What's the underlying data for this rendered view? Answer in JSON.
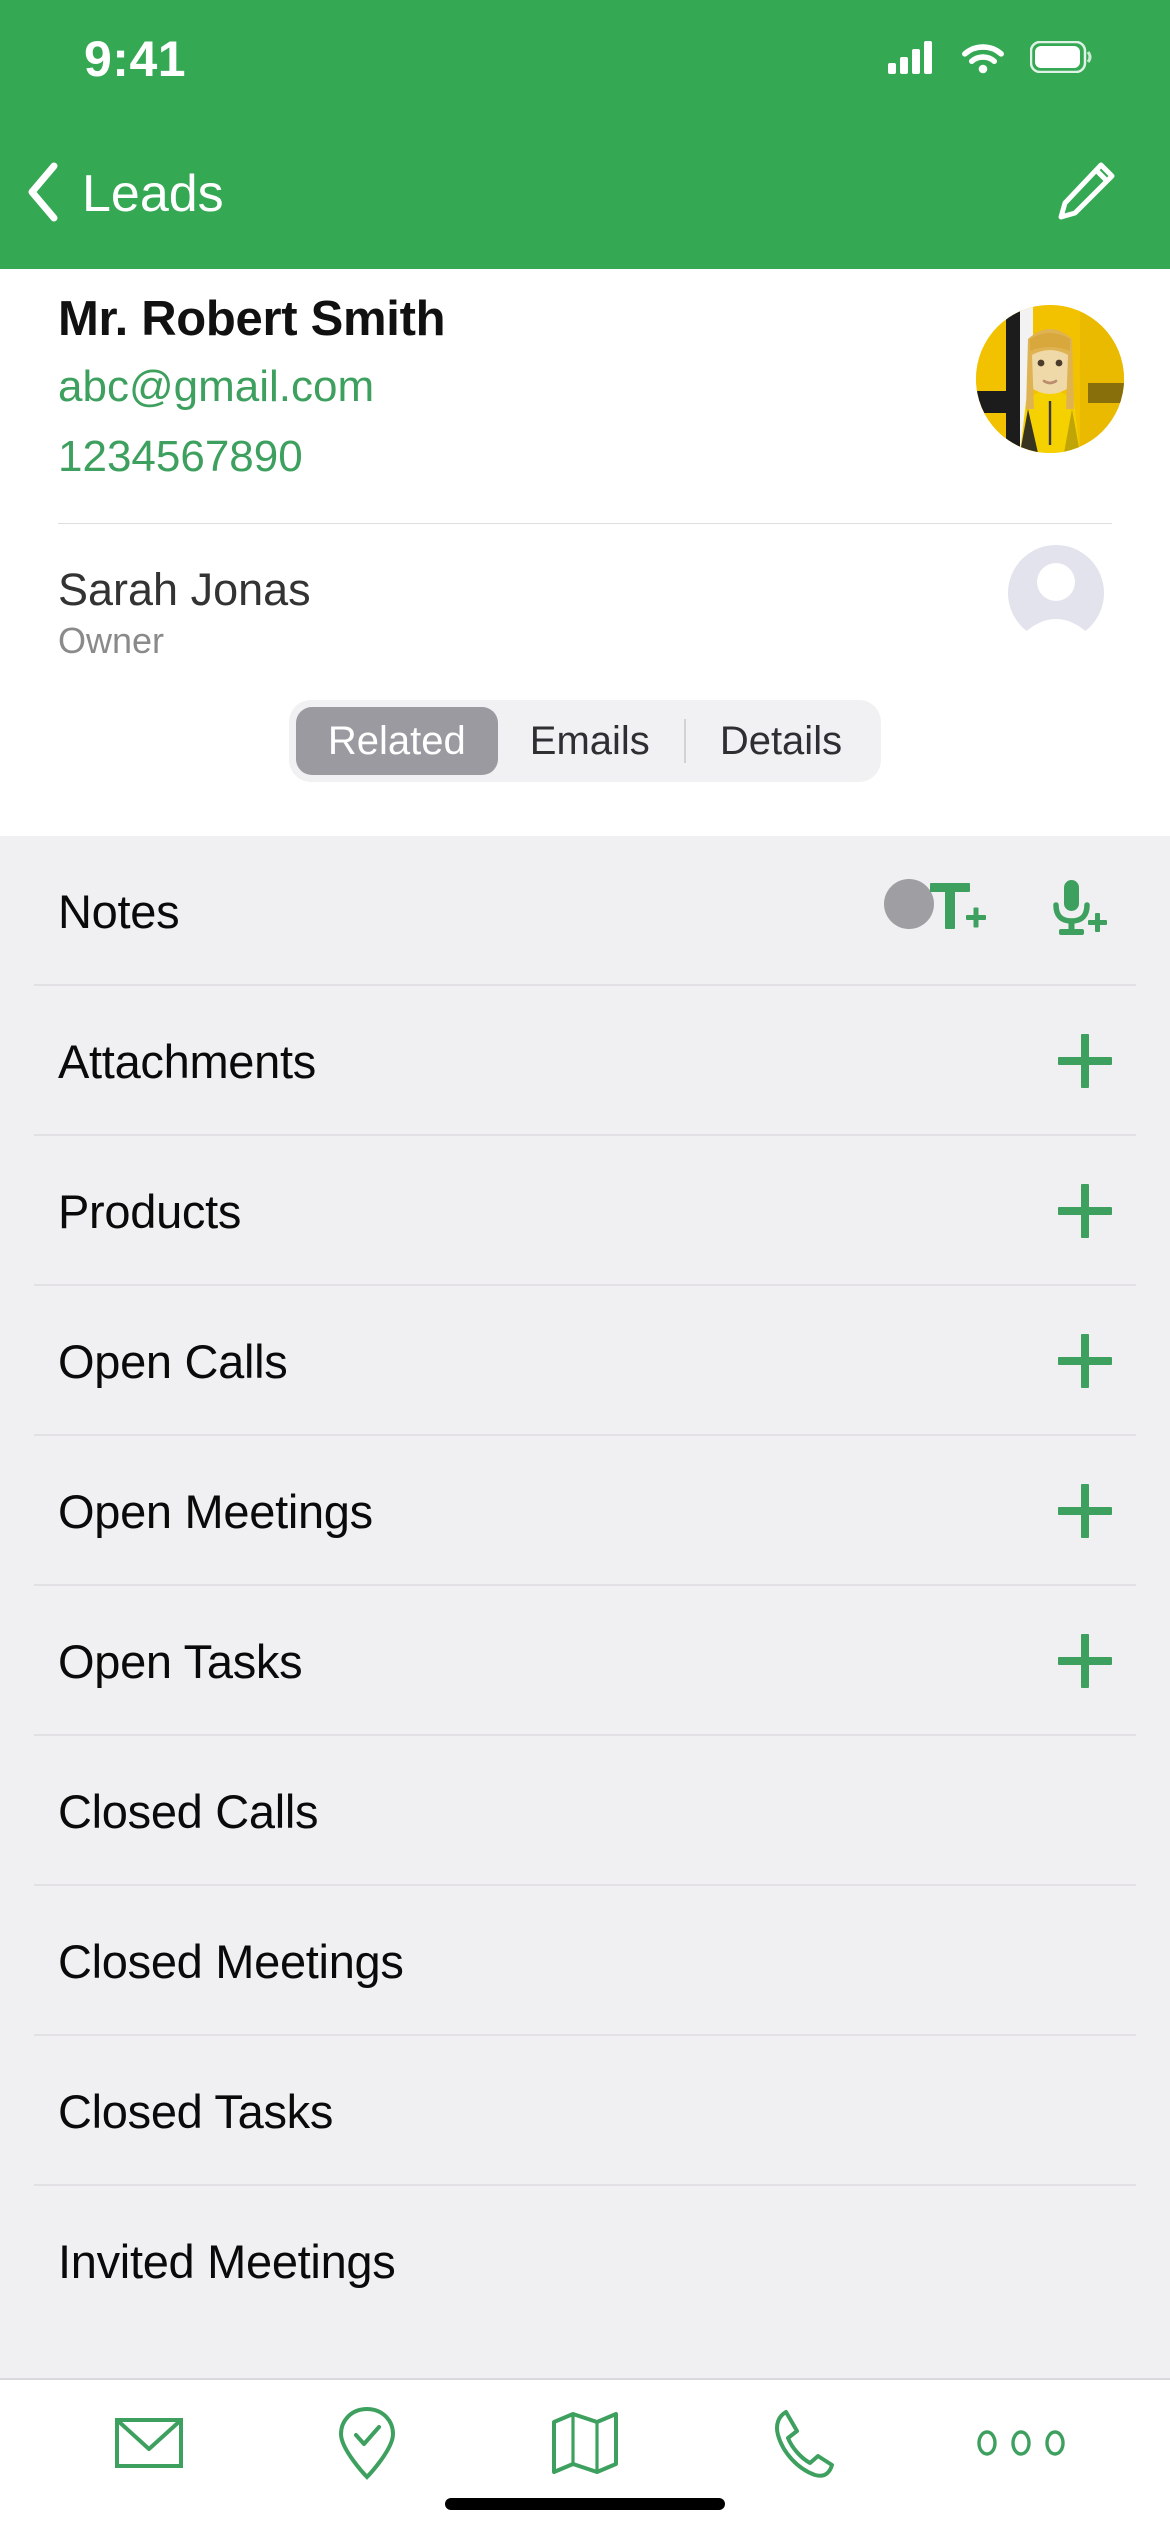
{
  "status_bar": {
    "time": "9:41",
    "cellular_icon": "cellular-signal-icon",
    "wifi_icon": "wifi-icon",
    "battery_icon": "battery-icon"
  },
  "nav": {
    "back_icon": "chevron-left-icon",
    "title": "Leads",
    "edit_icon": "pencil-edit-icon"
  },
  "contact": {
    "name": "Mr. Robert Smith",
    "email": "abc@gmail.com",
    "phone": "1234567890",
    "avatar_icon": "contact-photo-avatar"
  },
  "owner": {
    "name": "Sarah Jonas",
    "role": "Owner",
    "avatar_icon": "person-placeholder-avatar"
  },
  "tabs": {
    "items": [
      {
        "label": "Related",
        "active": true
      },
      {
        "label": "Emails",
        "active": false
      },
      {
        "label": "Details",
        "active": false
      }
    ]
  },
  "related_list": {
    "rows": [
      {
        "label": "Notes",
        "actions": [
          "add-text-note-icon",
          "add-voice-note-icon"
        ]
      },
      {
        "label": "Attachments",
        "actions": [
          "plus-icon"
        ]
      },
      {
        "label": "Products",
        "actions": [
          "plus-icon"
        ]
      },
      {
        "label": "Open Calls",
        "actions": [
          "plus-icon"
        ]
      },
      {
        "label": "Open Meetings",
        "actions": [
          "plus-icon"
        ]
      },
      {
        "label": "Open Tasks",
        "actions": [
          "plus-icon"
        ]
      },
      {
        "label": "Closed Calls",
        "actions": []
      },
      {
        "label": "Closed Meetings",
        "actions": []
      },
      {
        "label": "Closed Tasks",
        "actions": []
      },
      {
        "label": "Invited Meetings",
        "actions": []
      }
    ]
  },
  "tab_bar": {
    "items": [
      {
        "icon": "envelope-icon"
      },
      {
        "icon": "check-in-pin-icon"
      },
      {
        "icon": "map-icon"
      },
      {
        "icon": "phone-icon"
      },
      {
        "icon": "more-dots-icon"
      }
    ]
  },
  "colors": {
    "brand_green": "#34a853",
    "accent_green": "#3da05e",
    "list_background": "#f0eff1",
    "tab_active_background": "#9a9aa0"
  }
}
